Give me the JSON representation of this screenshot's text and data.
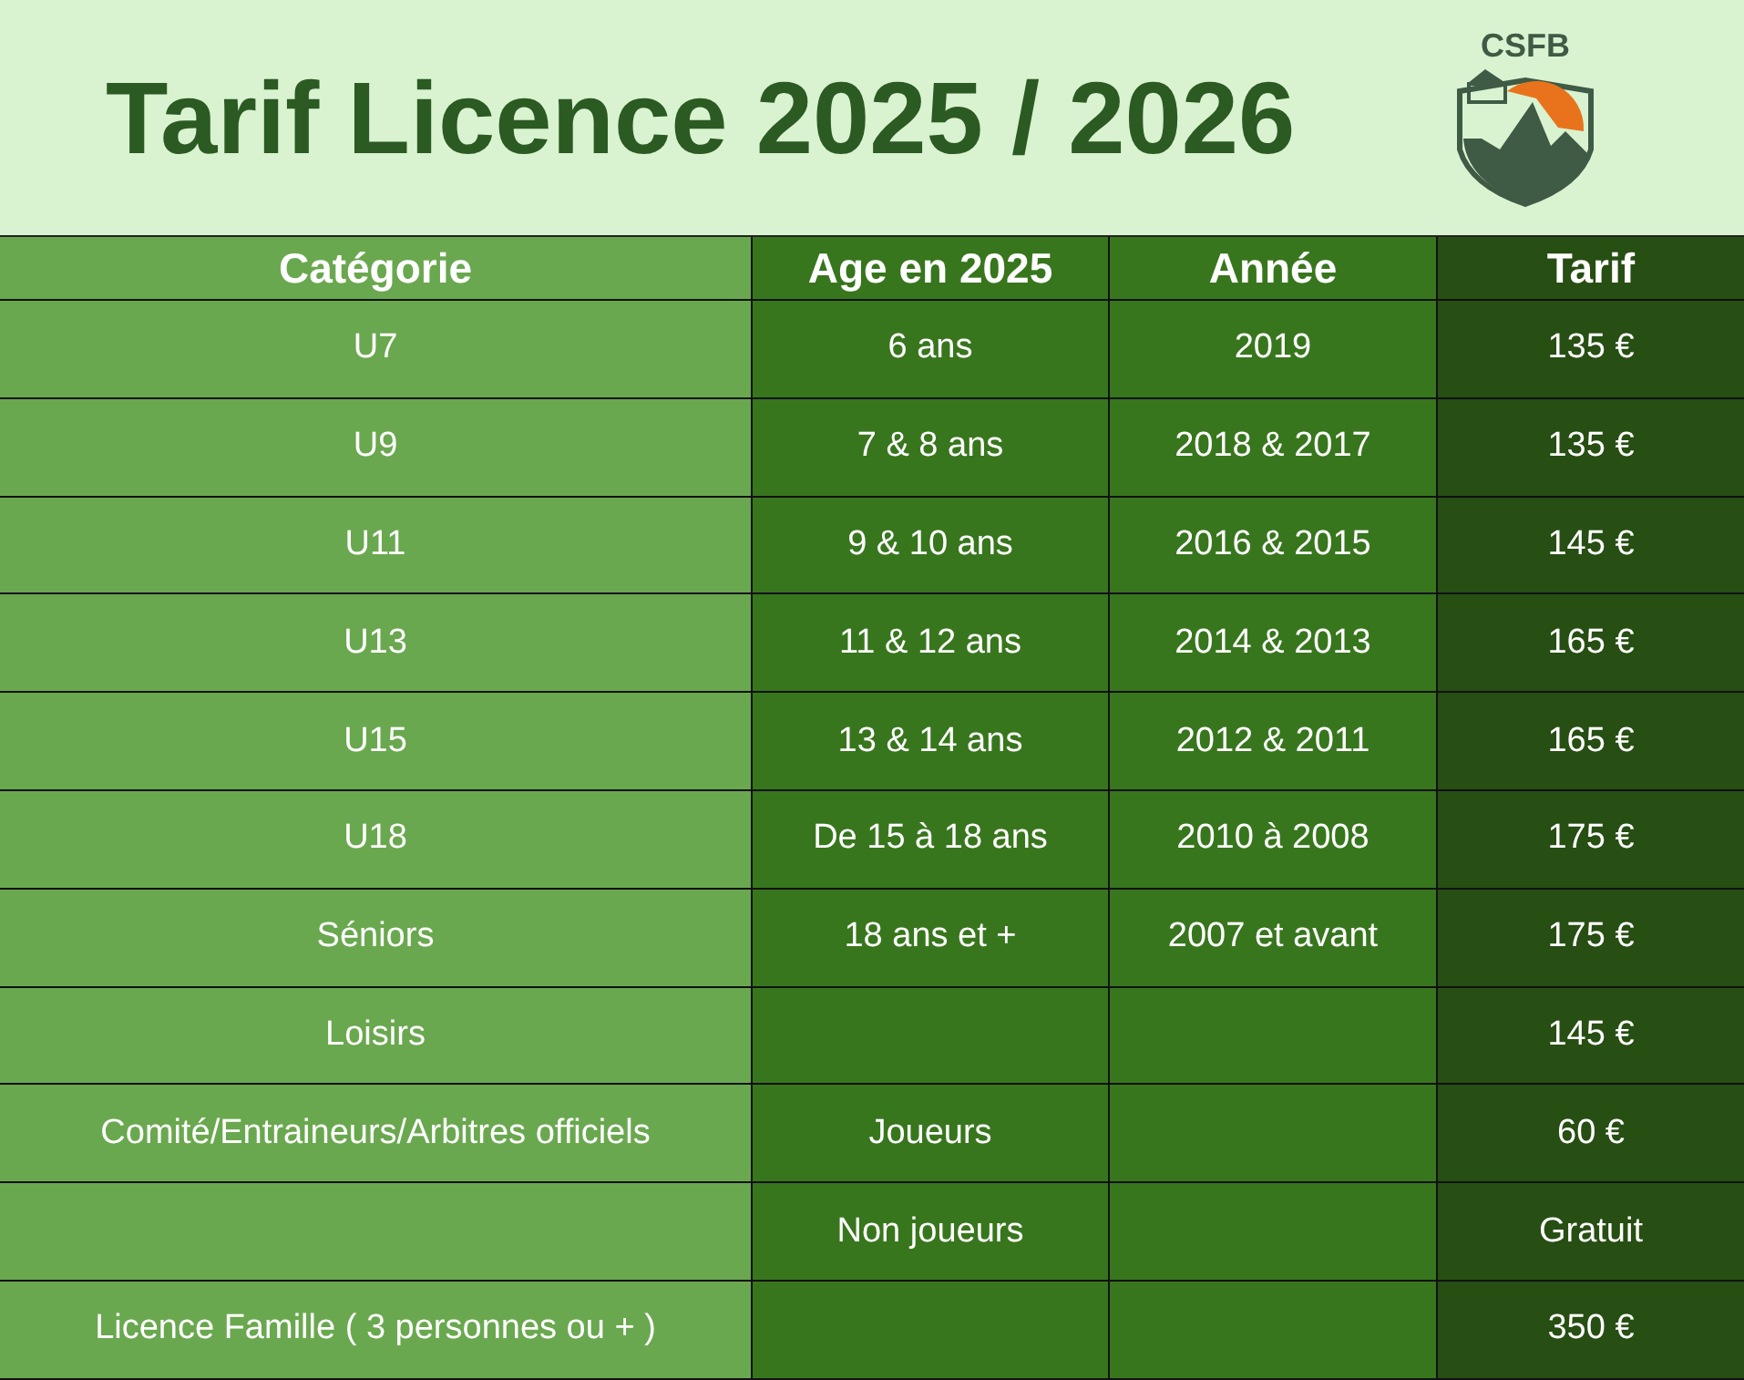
{
  "title": "Tarif Licence 2025 / 2026",
  "logo": {
    "text": "CSFB"
  },
  "columns": [
    "Catégorie",
    "Age en 2025",
    "Année",
    "Tarif"
  ],
  "rows": [
    {
      "category": "U7",
      "age": "6 ans",
      "year": "2019",
      "price": "135 €"
    },
    {
      "category": "U9",
      "age": "7 & 8 ans",
      "year": "2018 & 2017",
      "price": "135 €"
    },
    {
      "category": "U11",
      "age": "9 & 10 ans",
      "year": "2016 & 2015",
      "price": "145 €"
    },
    {
      "category": "U13",
      "age": "11 & 12 ans",
      "year": "2014 & 2013",
      "price": "165 €"
    },
    {
      "category": "U15",
      "age": "13 & 14 ans",
      "year": "2012 & 2011",
      "price": "165 €"
    },
    {
      "category": "U18",
      "age": "De 15 à 18 ans",
      "year": "2010 à 2008",
      "price": "175 €"
    },
    {
      "category": "Séniors",
      "age": "18 ans et +",
      "year": "2007 et avant",
      "price": "175 €"
    },
    {
      "category": "Loisirs",
      "price": "145 €"
    },
    {
      "category": "Comité/Entraineurs/Arbitres officiels",
      "age": "Joueurs",
      "price": "60 €"
    },
    {
      "age": "Non joueurs",
      "price": "Gratuit"
    },
    {
      "category": "Licence Famille ( 3 personnes ou + )",
      "price": "350 €"
    }
  ]
}
